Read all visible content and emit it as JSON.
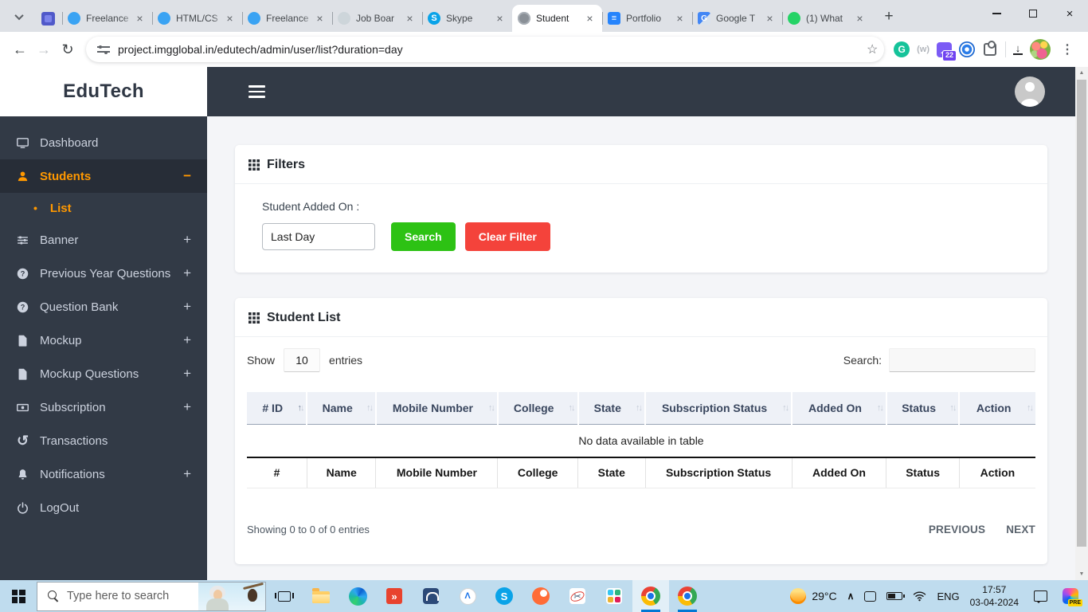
{
  "icons": {
    "close": "×",
    "plus": "+",
    "minus": "−",
    "back": "←",
    "forward": "→",
    "reload": "↻",
    "star": "☆",
    "kebab": "⋮",
    "download_arrow": "↓",
    "sort_up": "↑",
    "sort_down": "↓",
    "bullet": "•",
    "chevron_up": "∧",
    "scroll_up": "▲",
    "scroll_down": "▼",
    "history": "↺",
    "grammarly_letter": "G",
    "skype_letter": "S",
    "translate_letter": "G",
    "docs_lines": "≡",
    "red_app_glyph": "»",
    "compass_glyph": "Λ",
    "scissors": "✂",
    "w_ext": "(w)"
  },
  "browser": {
    "tabs": [
      {
        "title": "Freelance",
        "icon": "freelancer-bird"
      },
      {
        "title": "HTML/CS",
        "icon": "freelancer-bird"
      },
      {
        "title": "Freelance",
        "icon": "freelancer-bird"
      },
      {
        "title": "Job Boar",
        "icon": "chatgpt"
      },
      {
        "title": "Skype",
        "icon": "skype"
      },
      {
        "title": "Student",
        "icon": "globe"
      },
      {
        "title": "Portfolio",
        "icon": "docs"
      },
      {
        "title": "Google T",
        "icon": "google-translate"
      },
      {
        "title": "(1) What",
        "icon": "whatsapp"
      }
    ],
    "url": "project.imgglobal.in/edutech/admin/user/list?duration=day",
    "extension_badge": "22"
  },
  "sidebar": {
    "logo": "EduTech",
    "items": [
      {
        "label": "Dashboard",
        "expand": ""
      },
      {
        "label": "Students",
        "expand": "−"
      },
      {
        "label": "List",
        "expand": ""
      },
      {
        "label": "Banner",
        "expand": "+"
      },
      {
        "label": "Previous Year Questions",
        "expand": "+"
      },
      {
        "label": "Question Bank",
        "expand": "+"
      },
      {
        "label": "Mockup",
        "expand": "+"
      },
      {
        "label": "Mockup Questions",
        "expand": "+"
      },
      {
        "label": "Subscription",
        "expand": "+"
      },
      {
        "label": "Transactions",
        "expand": ""
      },
      {
        "label": "Notifications",
        "expand": "+"
      },
      {
        "label": "LogOut",
        "expand": ""
      }
    ]
  },
  "filters": {
    "title": "Filters",
    "added_on_label": "Student Added On :",
    "added_on_value": "Last Day",
    "search_button": "Search",
    "clear_button": "Clear Filter"
  },
  "student_list": {
    "title": "Student List",
    "show_label": "Show",
    "entries_value": "10",
    "entries_label": "entries",
    "search_label": "Search:",
    "columns": [
      "# ID",
      "Name",
      "Mobile Number",
      "College",
      "State",
      "Subscription Status",
      "Added On",
      "Status",
      "Action"
    ],
    "footer_columns": [
      "#",
      "Name",
      "Mobile Number",
      "College",
      "State",
      "Subscription Status",
      "Added On",
      "Status",
      "Action"
    ],
    "empty_text": "No data available in table",
    "info_text": "Showing 0 to 0 of 0 entries",
    "previous_label": "PREVIOUS",
    "next_label": "NEXT"
  },
  "taskbar": {
    "search_placeholder": "Type here to search",
    "temperature": "29°C",
    "language": "ENG",
    "time": "17:57",
    "date": "03-04-2024",
    "copilot_badge": "PRE"
  },
  "colors": {
    "accent_orange": "#ff9800",
    "sidebar_bg": "#323a46",
    "button_green": "#2dc214",
    "button_red": "#f4433b",
    "taskbar_bg": "#bfdcee"
  }
}
